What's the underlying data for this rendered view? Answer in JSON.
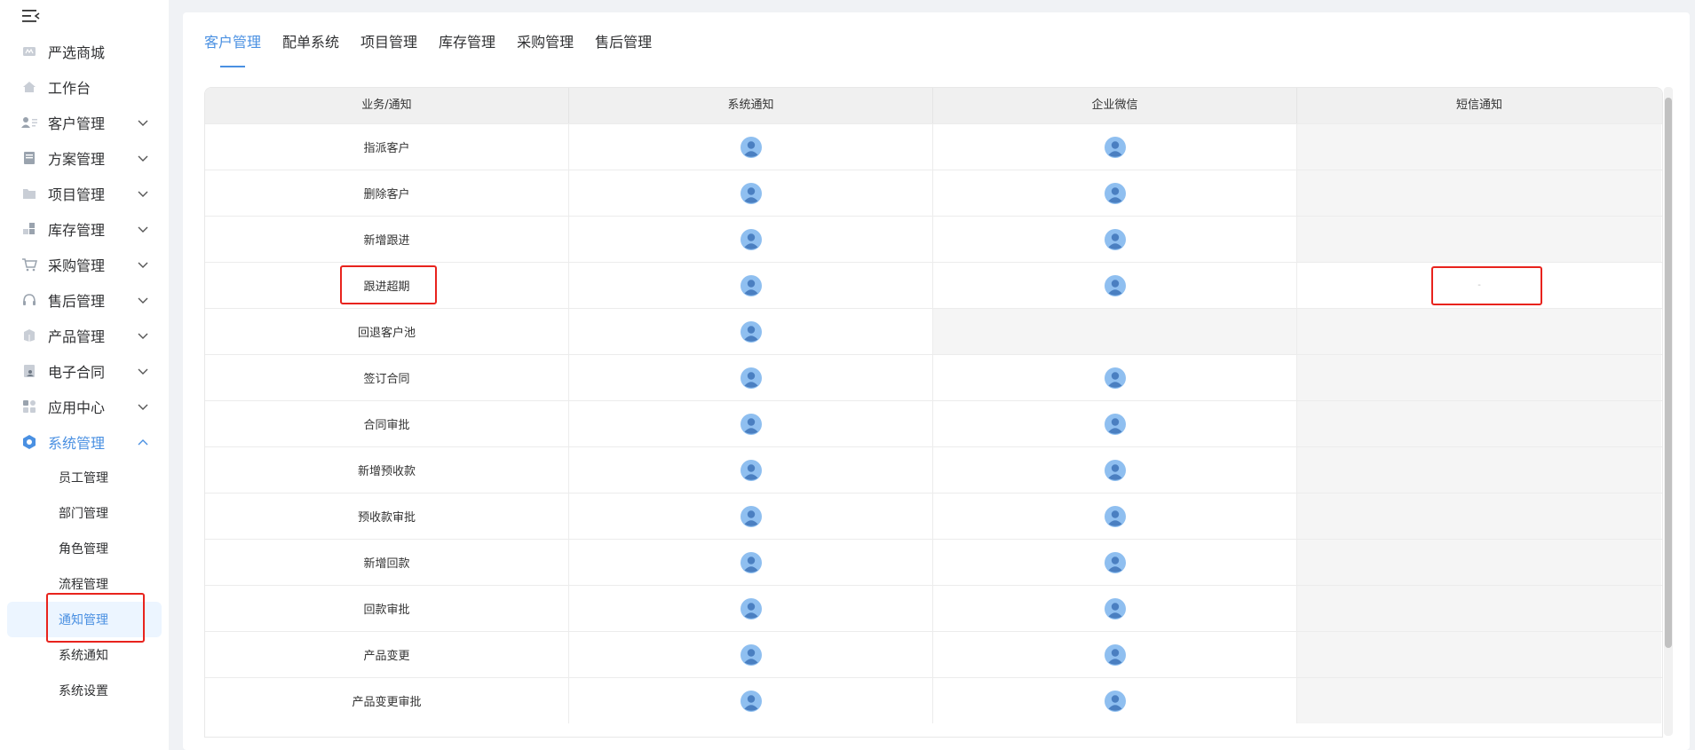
{
  "sidebar": {
    "items": [
      {
        "label": "严选商城",
        "icon": "mall-icon",
        "has_children": false
      },
      {
        "label": "工作台",
        "icon": "home-icon",
        "has_children": false
      },
      {
        "label": "客户管理",
        "icon": "customer-card-icon",
        "has_children": true
      },
      {
        "label": "方案管理",
        "icon": "document-icon",
        "has_children": true
      },
      {
        "label": "项目管理",
        "icon": "folder-icon",
        "has_children": true
      },
      {
        "label": "库存管理",
        "icon": "inventory-blocks-icon",
        "has_children": true
      },
      {
        "label": "采购管理",
        "icon": "cart-icon",
        "has_children": true
      },
      {
        "label": "售后管理",
        "icon": "headset-icon",
        "has_children": true
      },
      {
        "label": "产品管理",
        "icon": "box-icon",
        "has_children": true
      },
      {
        "label": "电子合同",
        "icon": "contract-icon",
        "has_children": true
      },
      {
        "label": "应用中心",
        "icon": "apps-grid-icon",
        "has_children": true
      },
      {
        "label": "系统管理",
        "icon": "hexagon-gear-icon",
        "has_children": true,
        "expanded": true
      }
    ],
    "sub_items": [
      "员工管理",
      "部门管理",
      "角色管理",
      "流程管理",
      "通知管理",
      "系统通知",
      "系统设置"
    ],
    "selected_sub": "通知管理"
  },
  "tabs": [
    "客户管理",
    "配单系统",
    "项目管理",
    "库存管理",
    "采购管理",
    "售后管理"
  ],
  "active_tab": "客户管理",
  "table": {
    "headers": [
      "业务/通知",
      "系统通知",
      "企业微信",
      "短信通知"
    ],
    "rows": [
      {
        "name": "指派客户",
        "system": true,
        "wecom": true,
        "sms": false
      },
      {
        "name": "删除客户",
        "system": true,
        "wecom": true,
        "sms": false
      },
      {
        "name": "新增跟进",
        "system": true,
        "wecom": true,
        "sms": false
      },
      {
        "name": "跟进超期",
        "system": true,
        "wecom": true,
        "sms": "-"
      },
      {
        "name": "回退客户池",
        "system": true,
        "wecom": false,
        "sms": false
      },
      {
        "name": "签订合同",
        "system": true,
        "wecom": true,
        "sms": false
      },
      {
        "name": "合同审批",
        "system": true,
        "wecom": true,
        "sms": false
      },
      {
        "name": "新增预收款",
        "system": true,
        "wecom": true,
        "sms": false
      },
      {
        "name": "预收款审批",
        "system": true,
        "wecom": true,
        "sms": false
      },
      {
        "name": "新增回款",
        "system": true,
        "wecom": true,
        "sms": false
      },
      {
        "name": "回款审批",
        "system": true,
        "wecom": true,
        "sms": false
      },
      {
        "name": "产品变更",
        "system": true,
        "wecom": true,
        "sms": false
      },
      {
        "name": "产品变更审批",
        "system": true,
        "wecom": true,
        "sms": false
      }
    ]
  },
  "colors": {
    "accent": "#4a90e2",
    "highlight": "#e8231d",
    "avatar": "#8fbff0"
  }
}
